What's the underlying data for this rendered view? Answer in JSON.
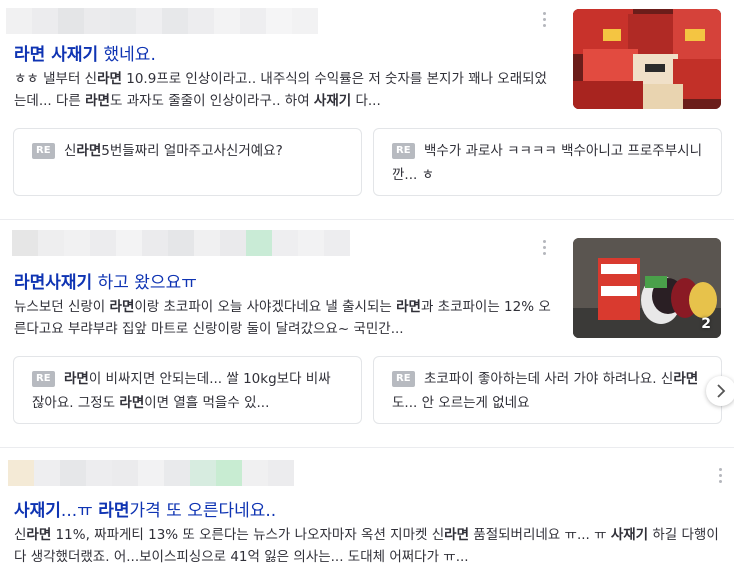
{
  "posts": [
    {
      "title_parts": [
        "라면 사재기",
        " 했네요."
      ],
      "desc_parts": [
        "ㅎㅎ 낼부터 신",
        "라면",
        " 10.9프로 인상이라고.. 내주식의 수익률은 저 숫자를 본지가 꽤나 오래되었는데... 다른 ",
        "라면",
        "도 과자도 줄줄이 인상이라구.. 하여 ",
        "사재기",
        " 다..."
      ],
      "replies": [
        {
          "badge": "RE",
          "parts": [
            "신",
            "라면",
            "5번들짜리 얼마주고사신거예요?"
          ]
        },
        {
          "badge": "RE",
          "parts": [
            "백수가 과로사 ㅋㅋㅋㅋ 백수아니고 프로주부시니깐... ㅎ"
          ]
        }
      ],
      "thumb_count": ""
    },
    {
      "title_parts": [
        "라면사재기",
        " 하고 왔으요ㅠ"
      ],
      "desc_parts": [
        "뉴스보던 신랑이 ",
        "라면",
        "이랑 초코파이 오늘 사야겠다네요 낼 출시되는 ",
        "라면",
        "과 초코파이는 12% 오른다고요 부랴부랴 집앞 마트로 신랑이랑 둘이 달려갔으요~ 국민간..."
      ],
      "replies": [
        {
          "badge": "RE",
          "parts": [
            "",
            "라면",
            "이 비싸지면 안되는데... 쌀 10kg보다 비싸잖아요. 그정도 ",
            "라면",
            "이면 열흘 먹을수 있..."
          ]
        },
        {
          "badge": "RE",
          "parts": [
            "초코파이 좋아하는데 사러 가야 하려나요. 신",
            "라면",
            "도... 안 오르는게 없네요"
          ]
        }
      ],
      "thumb_count": "2"
    },
    {
      "title_parts": [
        "사재기",
        "...ㅠ ",
        "라면",
        "가격 또 오른다네요.."
      ],
      "desc_parts": [
        "신",
        "라면",
        " 11%, 짜파게티 13% 또 오른다는 뉴스가 나오자마자 옥션 지마켓 신",
        "라면",
        " 품절되버리네요 ㅠ... ㅠ ",
        "사재기",
        " 하길 다행이다 생각했더랬죠. 어...보이스피싱으로 41억 잃은 의사는... 도대체 어쩌다가 ㅠ..."
      ]
    }
  ],
  "icons": {
    "kebab": "more-vertical-icon",
    "next": "chevron-right-icon"
  },
  "colors": {
    "title": "#0f34b3",
    "text": "#303038",
    "badge": "#b7bac0",
    "border": "#e3e5e8"
  }
}
